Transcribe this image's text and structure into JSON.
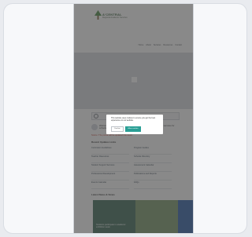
{
  "site": {
    "logo_text": "A'CENTRAL",
    "logo_tagline": "Regional Academic Services",
    "nav": [
      "Home",
      "About",
      "Services",
      "Resources",
      "Contact"
    ],
    "search_placeholder": "Search",
    "welcome": "Welcome to the regional academic portal. Find resources, news and services for schools.",
    "alert": "Notice: The portal will be updated this week.",
    "quick_links_title": "Recent Updates Links",
    "quick_links": [
      "Curriculum Guidelines",
      "Program Guides",
      "Teacher Resources",
      "Schools Directory",
      "Student Support Services",
      "Assessment Calendar",
      "Professional Development",
      "Publications and Reports",
      "Events Calendar",
      "FAQs"
    ],
    "news_title": "Latest News & Views",
    "photos": [
      {
        "caption": "Students participate in academic exhibition week",
        "color": "#3d6b57"
      },
      {
        "caption": "",
        "color": "#7a9a6a"
      },
      {
        "caption": "",
        "color": "#2f5fa8"
      }
    ]
  },
  "cookie": {
    "text": "This website uses cookies to ensure you get the best experience on our website.",
    "decline": "Decline",
    "accept": "Allow cookies"
  }
}
